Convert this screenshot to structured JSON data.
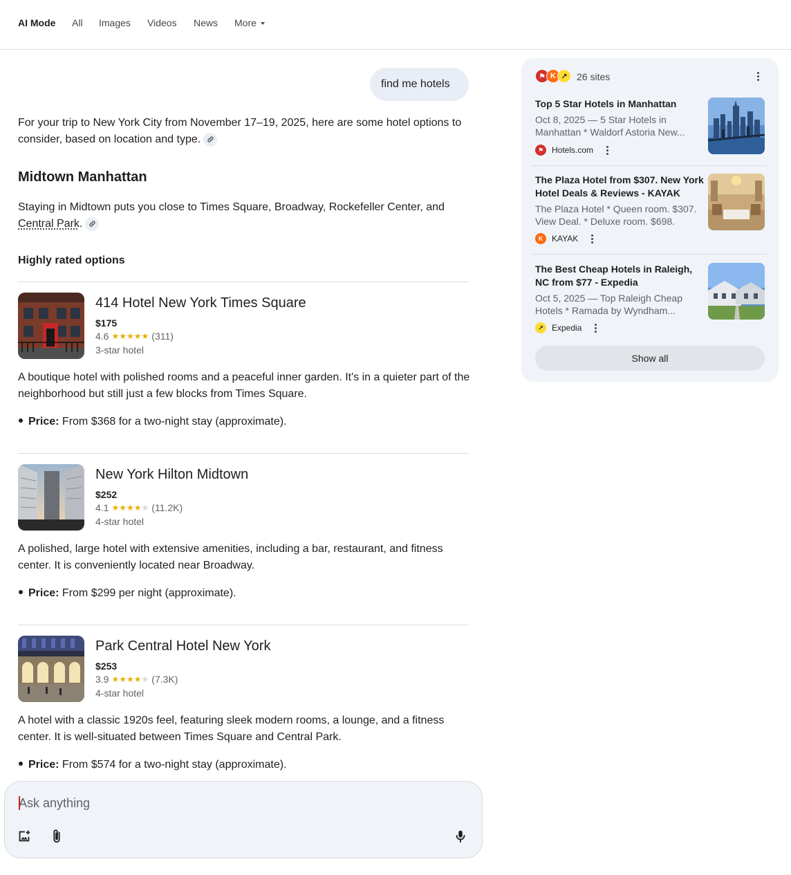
{
  "nav": {
    "tabs": [
      {
        "label": "AI Mode"
      },
      {
        "label": "All"
      },
      {
        "label": "Images"
      },
      {
        "label": "Videos"
      },
      {
        "label": "News"
      },
      {
        "label": "More"
      }
    ]
  },
  "query": "find me hotels",
  "intro": "For your trip to New York City from November 17–19, 2025, here are some hotel options to consider, based on location and type.",
  "section": {
    "title": "Midtown Manhattan",
    "text_before": "Staying in Midtown puts you close to Times Square, Broadway, Rockefeller Center, and ",
    "linked": "Central Park",
    "text_after": ".",
    "subheading": "Highly rated options"
  },
  "hotels": [
    {
      "name": "414 Hotel New York Times Square",
      "price": "$175",
      "rating": "4.6",
      "rating_value": 4.6,
      "reviews": "(311)",
      "class": "3-star hotel",
      "desc": "A boutique hotel with polished rooms and a peaceful inner garden. It's in a quieter part of the neighborhood but still just a few blocks from Times Square.",
      "price_label": "Price:",
      "price_text": " From $368 for a two-night stay (approximate)."
    },
    {
      "name": "New York Hilton Midtown",
      "price": "$252",
      "rating": "4.1",
      "rating_value": 4.1,
      "reviews": "(11.2K)",
      "class": "4-star hotel",
      "desc": "A polished, large hotel with extensive amenities, including a bar, restaurant, and fitness center. It is conveniently located near Broadway.",
      "price_label": "Price:",
      "price_text": " From $299 per night (approximate)."
    },
    {
      "name": "Park Central Hotel New York",
      "price": "$253",
      "rating": "3.9",
      "rating_value": 3.9,
      "reviews": "(7.3K)",
      "class": "4-star hotel",
      "desc": "A hotel with a classic 1920s feel, featuring sleek modern rooms, a lounge, and a fitness center. It is well-situated between Times Square and Central Park.",
      "price_label": "Price:",
      "price_text": " From $574 for a two-night stay (approximate)."
    }
  ],
  "ask": {
    "placeholder": "Ask anything"
  },
  "sources": {
    "count_label": "26 sites",
    "items": [
      {
        "title": "Top 5 Star Hotels in Manhattan",
        "snippet": "Oct 8, 2025 — 5 Star Hotels in Manhattan * Waldorf Astoria New...",
        "site": "Hotels.com"
      },
      {
        "title": "The Plaza Hotel from $307. New York Hotel Deals & Reviews - KAYAK",
        "snippet": "The Plaza Hotel * Queen room. $307. View Deal. * Deluxe room. $698. Vie...",
        "site": "KAYAK"
      },
      {
        "title": "The Best Cheap Hotels in Raleigh, NC from $77 - Expedia",
        "snippet": "Oct 5, 2025 — Top Raleigh Cheap Hotels * Ramada by Wyndham...",
        "site": "Expedia"
      }
    ],
    "show_all": "Show all"
  },
  "colors": {
    "hotels_brand": "#d32f2f",
    "kayak_brand": "#ff690f",
    "expedia_brand": "#fddb32",
    "star": "#e8b000",
    "chip_bg": "#e9eef6",
    "panel_bg": "#f0f4f9"
  },
  "icons": {
    "link": "link-icon",
    "add_image": "add-image-icon",
    "attach": "paperclip-icon",
    "mic": "mic-icon",
    "more": "kebab-icon"
  }
}
